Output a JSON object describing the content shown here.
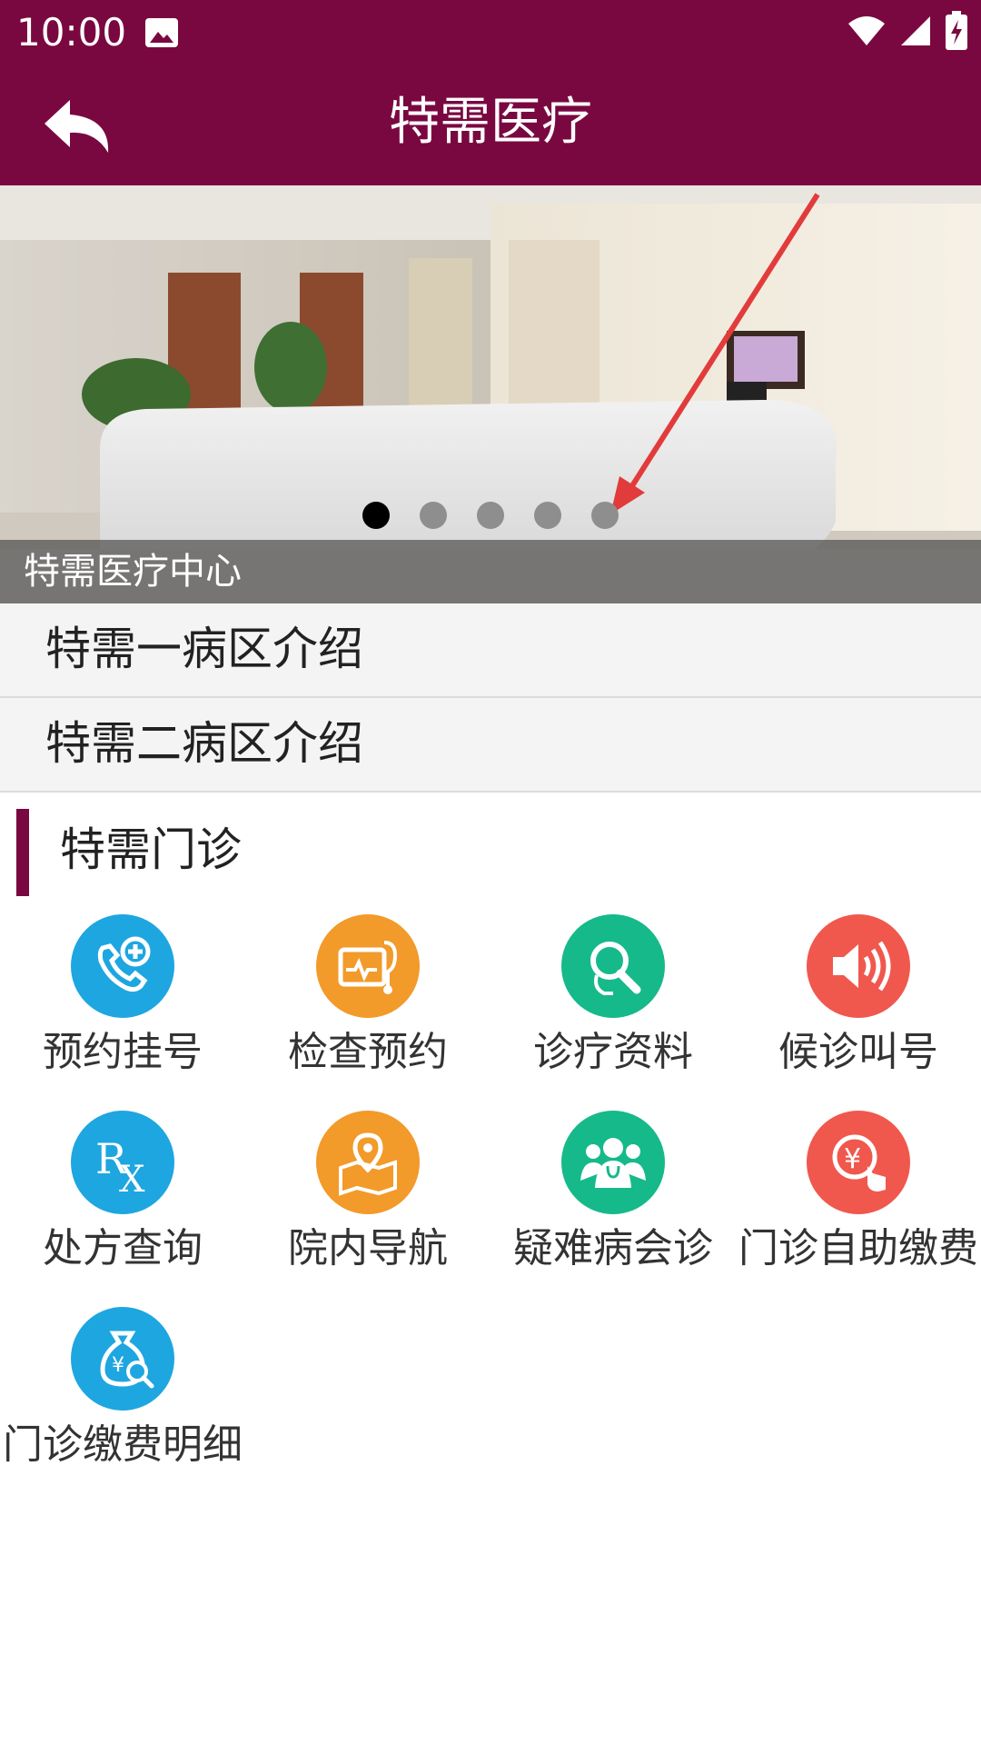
{
  "status_bar": {
    "time": "10:00"
  },
  "header": {
    "title": "特需医疗"
  },
  "banner": {
    "caption": "特需医疗中心",
    "slide_count": 5,
    "active_index": 0
  },
  "menu": [
    {
      "label": "特需一病区介绍"
    },
    {
      "label": "特需二病区介绍"
    }
  ],
  "section": {
    "title": "特需门诊"
  },
  "grid": [
    {
      "label": "预约挂号",
      "icon": "phone-plus-icon",
      "color": "#1ea6e0"
    },
    {
      "label": "检查预约",
      "icon": "stethoscope-monitor-icon",
      "color": "#f29a2a"
    },
    {
      "label": "诊疗资料",
      "icon": "magnifier-report-icon",
      "color": "#16b98a"
    },
    {
      "label": "候诊叫号",
      "icon": "speaker-icon",
      "color": "#f0584d"
    },
    {
      "label": "处方查询",
      "icon": "rx-icon",
      "color": "#1ea6e0"
    },
    {
      "label": "院内导航",
      "icon": "map-pin-icon",
      "color": "#f29a2a"
    },
    {
      "label": "疑难病会诊",
      "icon": "doctors-group-icon",
      "color": "#16b98a"
    },
    {
      "label": "门诊自助缴费",
      "icon": "yuan-touch-icon",
      "color": "#f0584d"
    },
    {
      "label": "门诊缴费明细",
      "icon": "money-bag-search-icon",
      "color": "#1ea6e0"
    }
  ],
  "colors": {
    "brand": "#7a0840"
  }
}
